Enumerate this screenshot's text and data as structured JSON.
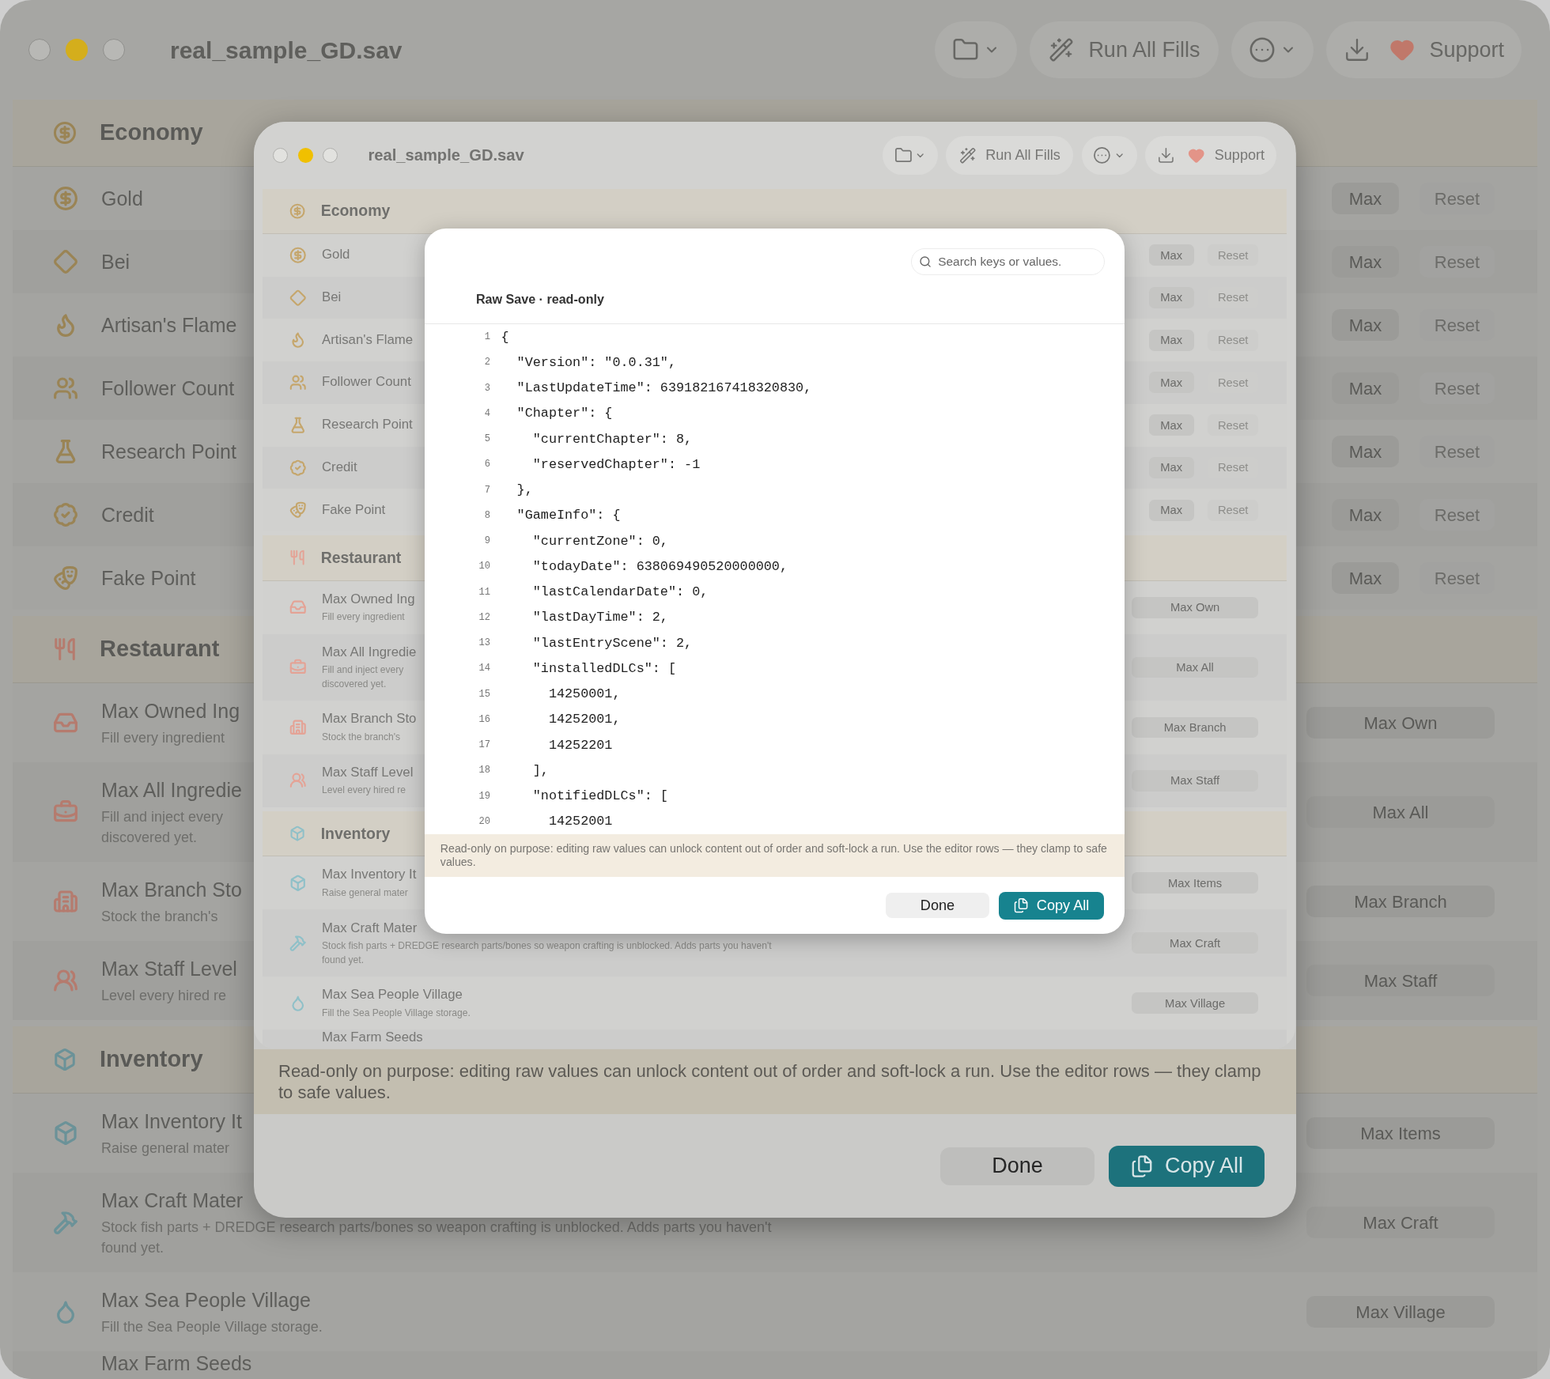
{
  "window": {
    "title": "real_sample_GD.sav",
    "toolbar": [
      {
        "kind": "folder"
      },
      {
        "kind": "wand",
        "label": "Run All Fills"
      },
      {
        "kind": "more"
      },
      {
        "kind": "support",
        "label": "Support"
      }
    ]
  },
  "sections": [
    {
      "title": "Economy",
      "rows": [
        {
          "kind": "stat",
          "label": "Gold",
          "buttons": [
            {
              "label": "Max",
              "disabled": false
            },
            {
              "label": "Reset",
              "disabled": true
            }
          ]
        },
        {
          "kind": "stat",
          "label": "Bei",
          "buttons": [
            {
              "label": "Max",
              "disabled": false
            },
            {
              "label": "Reset",
              "disabled": true
            }
          ]
        },
        {
          "kind": "stat",
          "label": "Artisan's Flame",
          "buttons": [
            {
              "label": "Max",
              "disabled": false
            },
            {
              "label": "Reset",
              "disabled": true
            }
          ]
        },
        {
          "kind": "stat",
          "label": "Follower Count",
          "buttons": [
            {
              "label": "Max",
              "disabled": false
            },
            {
              "label": "Reset",
              "disabled": true
            }
          ]
        },
        {
          "kind": "stat",
          "label": "Research Point",
          "buttons": [
            {
              "label": "Max",
              "disabled": false
            },
            {
              "label": "Reset",
              "disabled": true
            }
          ]
        },
        {
          "kind": "stat",
          "label": "Credit",
          "buttons": [
            {
              "label": "Max",
              "disabled": false
            },
            {
              "label": "Reset",
              "disabled": true
            }
          ]
        },
        {
          "kind": "stat",
          "label": "Fake Point",
          "buttons": [
            {
              "label": "Max",
              "disabled": false
            },
            {
              "label": "Reset",
              "disabled": true
            }
          ]
        }
      ]
    },
    {
      "title": "Restaurant",
      "rows": [
        {
          "kind": "fill",
          "label": "Max Owned Ing",
          "description": [
            "Fill every ingredient"
          ],
          "buttons": [
            {
              "label": "Max Own",
              "disabled": false
            }
          ]
        },
        {
          "kind": "fill",
          "label": "Max All Ingredie",
          "description": [
            "Fill and inject every",
            "discovered yet."
          ],
          "buttons": [
            {
              "label": "Max All",
              "disabled": false
            }
          ]
        },
        {
          "kind": "fill",
          "label": "Max Branch Sto",
          "description": [
            "Stock the branch's"
          ],
          "buttons": [
            {
              "label": "Max Branch",
              "disabled": false
            }
          ]
        },
        {
          "kind": "fill",
          "label": "Max Staff Level",
          "description": [
            "Level every hired re"
          ],
          "buttons": [
            {
              "label": "Max Staff",
              "disabled": false
            }
          ]
        }
      ]
    },
    {
      "title": "Inventory",
      "rows": [
        {
          "kind": "fill",
          "label": "Max Inventory It",
          "description": [
            "Raise general mater"
          ],
          "buttons": [
            {
              "label": "Max Items",
              "disabled": false
            }
          ]
        },
        {
          "kind": "fill",
          "label": "Max Craft Mater",
          "description": [
            "Stock fish parts + DREDGE research parts/bones so weapon crafting is unblocked. Adds parts you haven't",
            "found yet."
          ],
          "buttons": [
            {
              "label": "Max Craft",
              "disabled": false
            }
          ]
        },
        {
          "kind": "fill",
          "label": "Max Sea People Village",
          "description": [
            "Fill the Sea People Village storage."
          ],
          "buttons": [
            {
              "label": "Max Village",
              "disabled": false
            }
          ]
        },
        {
          "kind": "fill",
          "label": "Max Farm Seeds"
        }
      ]
    }
  ],
  "sheet": {
    "preview": {
      "window": {
        "title": "real_sample_GD.sav",
        "toolbar": [
          {
            "kind": "folder"
          },
          {
            "kind": "wand",
            "label": "Run All Fills"
          },
          {
            "kind": "more"
          },
          {
            "kind": "support",
            "label": "Support"
          }
        ]
      },
      "sections": [
        {
          "title": "Economy",
          "rows": [
            {
              "kind": "stat",
              "label": "Gold",
              "buttons": [
                {
                  "label": "Max",
                  "disabled": false
                },
                {
                  "label": "Reset",
                  "disabled": true
                }
              ]
            },
            {
              "kind": "stat",
              "label": "Bei",
              "buttons": [
                {
                  "label": "Max",
                  "disabled": false
                },
                {
                  "label": "Reset",
                  "disabled": true
                }
              ]
            },
            {
              "kind": "stat",
              "label": "Artisan's Flame",
              "buttons": [
                {
                  "label": "Max",
                  "disabled": false
                },
                {
                  "label": "Reset",
                  "disabled": true
                }
              ]
            },
            {
              "kind": "stat",
              "label": "Follower Count",
              "buttons": [
                {
                  "label": "Max",
                  "disabled": false
                },
                {
                  "label": "Reset",
                  "disabled": true
                }
              ]
            },
            {
              "kind": "stat",
              "label": "Research Point",
              "buttons": [
                {
                  "label": "Max",
                  "disabled": false
                },
                {
                  "label": "Reset",
                  "disabled": true
                }
              ]
            },
            {
              "kind": "stat",
              "label": "Credit",
              "buttons": [
                {
                  "label": "Max",
                  "disabled": false
                },
                {
                  "label": "Reset",
                  "disabled": true
                }
              ]
            },
            {
              "kind": "stat",
              "label": "Fake Point",
              "buttons": [
                {
                  "label": "Max",
                  "disabled": false
                },
                {
                  "label": "Reset",
                  "disabled": true
                }
              ]
            }
          ]
        },
        {
          "title": "Restaurant",
          "rows": [
            {
              "kind": "fill",
              "label": "Max Owned Ing",
              "description": [
                "Fill every ingredient"
              ],
              "buttons": [
                {
                  "label": "Max Own",
                  "disabled": false
                }
              ]
            },
            {
              "kind": "fill",
              "label": "Max All Ingredie",
              "description": [
                "Fill and inject every",
                "discovered yet."
              ],
              "buttons": [
                {
                  "label": "Max All",
                  "disabled": false
                }
              ]
            },
            {
              "kind": "fill",
              "label": "Max Branch Sto",
              "description": [
                "Stock the branch's"
              ],
              "buttons": [
                {
                  "label": "Max Branch",
                  "disabled": false
                }
              ]
            },
            {
              "kind": "fill",
              "label": "Max Staff Level",
              "description": [
                "Level every hired re"
              ],
              "buttons": [
                {
                  "label": "Max Staff",
                  "disabled": false
                }
              ]
            }
          ]
        },
        {
          "title": "Inventory",
          "rows": [
            {
              "kind": "fill",
              "label": "Max Inventory It",
              "description": [
                "Raise general mater"
              ],
              "buttons": [
                {
                  "label": "Max Items",
                  "disabled": false
                }
              ]
            },
            {
              "kind": "fill",
              "label": "Max Craft Mater",
              "description": [
                "Stock fish parts + DREDGE research parts/bones so weapon crafting is unblocked. Adds parts you haven't",
                "found yet."
              ],
              "buttons": [
                {
                  "label": "Max Craft",
                  "disabled": false
                }
              ]
            },
            {
              "kind": "fill",
              "label": "Max Sea People Village",
              "description": [
                "Fill the Sea People Village storage."
              ],
              "buttons": [
                {
                  "label": "Max Village",
                  "disabled": false
                }
              ]
            },
            {
              "kind": "fill",
              "label": "Max Farm Seeds"
            }
          ]
        }
      ],
      "dialog": {
        "search_placeholder": "Search keys or values.",
        "title": "Raw Save · read-only",
        "lines": [
          {
            "number": "1",
            "code": "{"
          },
          {
            "number": "2",
            "code": "  \"Version\": \"0.0.31\","
          },
          {
            "number": "3",
            "code": "  \"LastUpdateTime\": 639182167418320830,"
          },
          {
            "number": "4",
            "code": "  \"Chapter\": {"
          },
          {
            "number": "5",
            "code": "    \"currentChapter\": 8,"
          },
          {
            "number": "6",
            "code": "    \"reservedChapter\": -1"
          },
          {
            "number": "7",
            "code": "  },"
          },
          {
            "number": "8",
            "code": "  \"GameInfo\": {"
          },
          {
            "number": "9",
            "code": "    \"currentZone\": 0,"
          },
          {
            "number": "10",
            "code": "    \"todayDate\": 638069490520000000,"
          },
          {
            "number": "11",
            "code": "    \"lastCalendarDate\": 0,"
          },
          {
            "number": "12",
            "code": "    \"lastDayTime\": 2,"
          },
          {
            "number": "13",
            "code": "    \"lastEntryScene\": 2,"
          },
          {
            "number": "14",
            "code": "    \"installedDLCs\": ["
          },
          {
            "number": "15",
            "code": "      14250001,"
          },
          {
            "number": "16",
            "code": "      14252001,"
          },
          {
            "number": "17",
            "code": "      14252201"
          },
          {
            "number": "18",
            "code": "    ],"
          },
          {
            "number": "19",
            "code": "    \"notifiedDLCs\": ["
          },
          {
            "number": "20",
            "code": "      14252001"
          }
        ],
        "notice": "Read-only on purpose: editing raw values can unlock content out of order and soft-lock a run. Use the editor rows — they clamp to safe values.",
        "buttons": [
          {
            "kind": "plain",
            "label": "Done"
          },
          {
            "kind": "primary",
            "label": "Copy All"
          }
        ]
      }
    },
    "notice": "Read-only on purpose: editing raw values can unlock content out of order and soft-lock a run. Use the editor rows — they clamp to safe values.",
    "buttons": [
      {
        "kind": "plain",
        "label": "Done"
      },
      {
        "kind": "primary",
        "label": "Copy All"
      }
    ]
  }
}
